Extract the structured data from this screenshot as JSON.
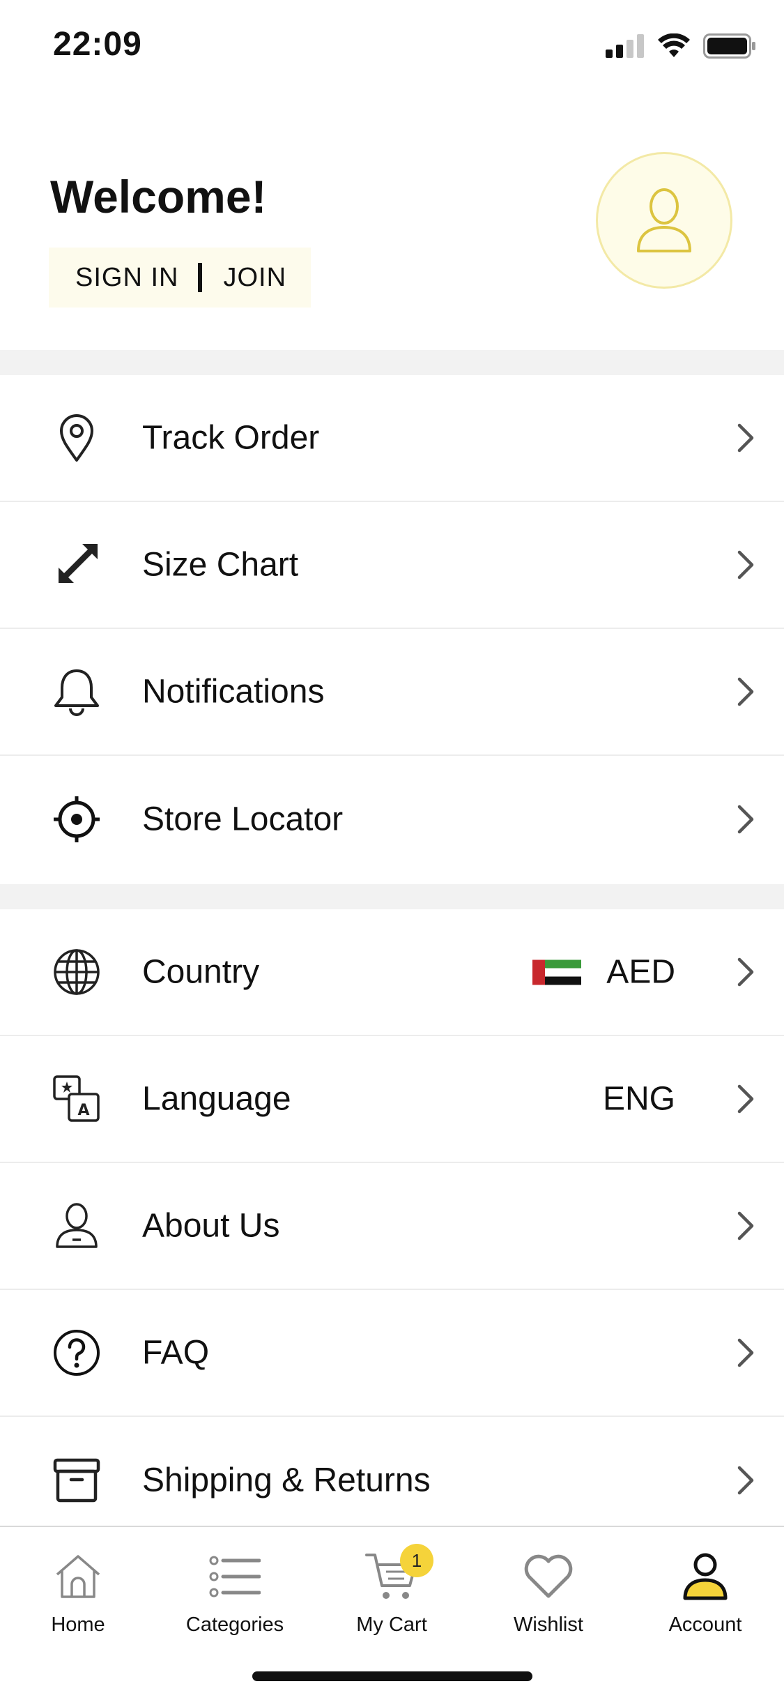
{
  "status_bar": {
    "time": "22:09"
  },
  "header": {
    "welcome": "Welcome!",
    "sign_in": "SIGN IN",
    "join": "JOIN"
  },
  "menu_primary": [
    {
      "label": "Track Order",
      "icon": "location-pin-icon"
    },
    {
      "label": "Size Chart",
      "icon": "expand-arrows-icon"
    },
    {
      "label": "Notifications",
      "icon": "bell-icon"
    },
    {
      "label": "Store Locator",
      "icon": "crosshair-icon"
    }
  ],
  "menu_secondary": [
    {
      "label": "Country",
      "value": "AED",
      "icon": "globe-icon"
    },
    {
      "label": "Language",
      "value": "ENG",
      "icon": "translate-icon"
    },
    {
      "label": "About Us",
      "icon": "person-icon"
    },
    {
      "label": "FAQ",
      "icon": "question-icon"
    },
    {
      "label": "Shipping & Returns",
      "icon": "box-icon"
    }
  ],
  "tab_bar": {
    "items": [
      {
        "label": "Home",
        "icon": "home-icon"
      },
      {
        "label": "Categories",
        "icon": "list-icon"
      },
      {
        "label": "My Cart",
        "icon": "cart-icon",
        "badge": "1"
      },
      {
        "label": "Wishlist",
        "icon": "heart-icon"
      },
      {
        "label": "Account",
        "icon": "account-icon",
        "active": true
      }
    ]
  },
  "colors": {
    "accent_yellow": "#f5d33a",
    "avatar_bg": "#fefce8",
    "auth_bg": "#fdfbec",
    "separator": "#f2f2f2",
    "flag_red": "#c8282d",
    "flag_green": "#3a9a3a"
  }
}
